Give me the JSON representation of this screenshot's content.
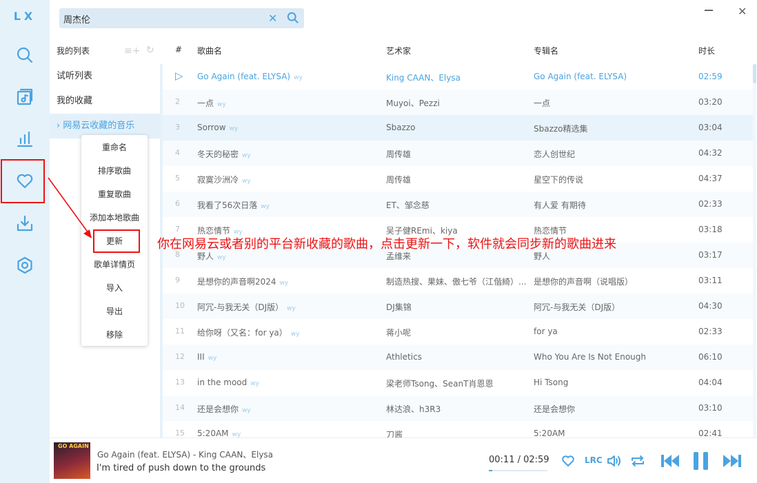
{
  "app": {
    "logo": "LX"
  },
  "nav": {
    "items": [
      {
        "name": "search",
        "icon": "search-icon"
      },
      {
        "name": "song-list",
        "icon": "playlist-icon"
      },
      {
        "name": "leaderboard",
        "icon": "bar-chart-icon"
      },
      {
        "name": "my-list",
        "icon": "heart-icon"
      },
      {
        "name": "download",
        "icon": "download-icon"
      },
      {
        "name": "settings",
        "icon": "settings-icon"
      }
    ]
  },
  "search": {
    "value": "周杰伦"
  },
  "lists": {
    "header": "我的列表",
    "items": [
      {
        "label": "试听列表"
      },
      {
        "label": "我的收藏"
      },
      {
        "label": "网易云收藏的音乐",
        "active": true
      }
    ]
  },
  "context_menu": {
    "items": [
      "重命名",
      "排序歌曲",
      "重复歌曲",
      "添加本地歌曲",
      "更新",
      "歌单详情页",
      "导入",
      "导出",
      "移除"
    ]
  },
  "annotation": {
    "text": "你在网易云或者别的平台新收藏的歌曲，点击更新一下，软件就会同步新的歌曲进来"
  },
  "table": {
    "headers": {
      "num": "#",
      "name": "歌曲名",
      "artist": "艺术家",
      "album": "专辑名",
      "duration": "时长"
    },
    "source_tag": "wy",
    "rows": [
      {
        "num": "1",
        "name": "Go Again (feat. ELYSA)",
        "artist": "King CAAN、Elysa",
        "album": "Go Again (feat. ELYSA)",
        "duration": "02:59"
      },
      {
        "num": "2",
        "name": "一点",
        "artist": "Muyoi、Pezzi",
        "album": "一点",
        "duration": "03:20"
      },
      {
        "num": "3",
        "name": "Sorrow",
        "artist": "Sbazzo",
        "album": "Sbazzo精选集",
        "duration": "03:04"
      },
      {
        "num": "4",
        "name": "冬天的秘密",
        "artist": "周传雄",
        "album": "恋人创世纪",
        "duration": "04:32"
      },
      {
        "num": "5",
        "name": "寂寞沙洲冷",
        "artist": "周传雄",
        "album": "星空下的传说",
        "duration": "04:37"
      },
      {
        "num": "6",
        "name": "我看了56次日落",
        "artist": "ET、邹念慈",
        "album": "有人爱 有期待",
        "duration": "02:33"
      },
      {
        "num": "7",
        "name": "热恋情节",
        "artist": "吴子健REmi、kiya",
        "album": "热恋情节",
        "duration": "03:18"
      },
      {
        "num": "8",
        "name": "野人",
        "artist": "孟维来",
        "album": "野人",
        "duration": "03:17"
      },
      {
        "num": "9",
        "name": "是想你的声音啊2024",
        "artist": "制造热搜、果妹、傲七爷（江偕綺）...",
        "album": "是想你的声音啊（说唱版）",
        "duration": "03:11"
      },
      {
        "num": "10",
        "name": "阿冗-与我无关（DJ版）",
        "artist": "DJ集锦",
        "album": "阿冗-与我无关（DJ版）",
        "duration": "04:30"
      },
      {
        "num": "11",
        "name": "给你呀（又名：for ya）",
        "artist": "蒋小呢",
        "album": "for ya",
        "duration": "02:33"
      },
      {
        "num": "12",
        "name": "III",
        "artist": "Athletics",
        "album": "Who You Are Is Not Enough",
        "duration": "06:10"
      },
      {
        "num": "13",
        "name": "in the mood",
        "artist": "梁老师Tsong、SeanT肖恩恩",
        "album": "Hi Tsong",
        "duration": "04:04"
      },
      {
        "num": "14",
        "name": "还是会想你",
        "artist": "林达浪、h3R3",
        "album": "还是会想你",
        "duration": "03:10"
      },
      {
        "num": "15",
        "name": "5:20AM",
        "artist": "刀酱",
        "album": "5:20AM",
        "duration": "02:41"
      }
    ]
  },
  "player": {
    "cover_text": "GO AGAIN",
    "title": "Go Again (feat. ELYSA) - King CAAN、Elysa",
    "lyric": "I'm tired of push down to the grounds",
    "time": "00:11 / 02:59",
    "progress": 0.061,
    "lyric_button": "LRC"
  },
  "colors": {
    "accent": "#4aa3e0",
    "annotation": "#ee1111",
    "sidebar_bg": "#e6f2fa"
  }
}
